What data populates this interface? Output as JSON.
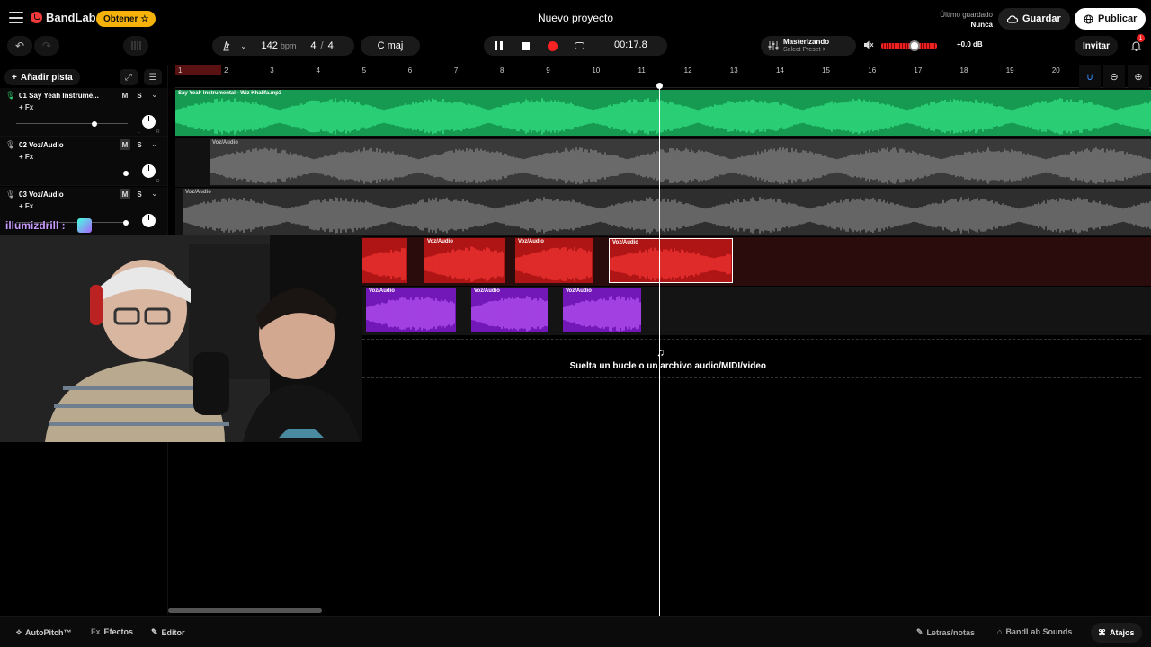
{
  "topbar": {
    "app_name": "BandLab",
    "get_button": "Obtener",
    "get_star": "☆",
    "project_title": "Nuevo proyecto",
    "last_saved_label": "Último guardado",
    "last_saved_value": "Nunca",
    "save_button": "Guardar",
    "publish_button": "Publicar"
  },
  "toolbar": {
    "undo_icon": "↶",
    "redo_icon": "↷",
    "tempo_value": "142",
    "tempo_unit": "bpm",
    "time_sig_num": "4",
    "time_sig_sep": "/",
    "time_sig_den": "4",
    "key": "C maj",
    "time": "00:17.8",
    "master_title": "Masterizando",
    "master_preset": "Select Preset >",
    "volume_db": "+0.0 dB",
    "volume_level": 0.6,
    "invite_button": "Invitar",
    "notification_count": "1"
  },
  "panel": {
    "add_track": "Añadir pista",
    "tracks": [
      {
        "number": "01",
        "name": "Say Yeah Instrume...",
        "mute": "M",
        "solo": "S",
        "fx": "+ Fx",
        "volume": 0.7
      },
      {
        "number": "02",
        "name": "Voz/Audio",
        "mute": "M",
        "solo": "S",
        "fx": "+ Fx",
        "volume": 0.98
      },
      {
        "number": "03",
        "name": "Voz/Audio",
        "mute": "M",
        "solo": "S",
        "fx": "+ Fx",
        "volume": 0.98
      }
    ]
  },
  "ruler": {
    "bars": [
      "1",
      "2",
      "3",
      "4",
      "5",
      "6",
      "7",
      "8",
      "9",
      "10",
      "11",
      "12",
      "13",
      "14",
      "15",
      "16",
      "17",
      "18",
      "19",
      "20"
    ]
  },
  "regions": {
    "track1_label": "Say Yeah Instrumental - Wiz Khalifa.mp3",
    "track2_label": "Voz/Audio",
    "track3_label": "Voz/Audio",
    "red_label": "Voz/Audio",
    "purple_label": "Voz/Audio"
  },
  "drop_zone": {
    "text": "Suelta un bucle o un archivo audio/MIDI/video"
  },
  "stream": {
    "username": "illumizdrill :"
  },
  "bottombar": {
    "autopitch": "AutoPitch™",
    "effects_prefix": "Fx",
    "effects": "Efectos",
    "editor": "Editor",
    "lyrics": "Letras/notas",
    "sounds": "BandLab Sounds",
    "shortcuts": "Atajos"
  },
  "colors": {
    "accent_red": "#f23a3a",
    "instrumental_green": "#22c06a",
    "vocal_red": "#e02020",
    "vocal_purple": "#8a1fd1",
    "gold": "#f5b20a"
  }
}
